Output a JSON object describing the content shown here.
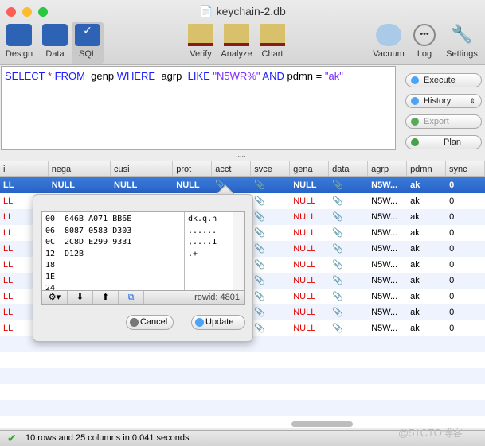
{
  "window": {
    "title": "keychain-2.db"
  },
  "toolbar": {
    "left": [
      {
        "label": "Design"
      },
      {
        "label": "Data"
      },
      {
        "label": "SQL",
        "selected": true
      }
    ],
    "center": [
      {
        "label": "Verify"
      },
      {
        "label": "Analyze"
      },
      {
        "label": "Chart"
      }
    ],
    "right": [
      {
        "label": "Vacuum"
      },
      {
        "label": "Log"
      },
      {
        "label": "Settings"
      }
    ]
  },
  "query": {
    "select": "SELECT",
    "star": "*",
    "from": "FROM",
    "table": "genp",
    "where": "WHERE",
    "col1": "agrp",
    "like": "LIKE",
    "pattern": "\"N5WR%\"",
    "and": "AND",
    "col2": "pdmn",
    "eq": "=",
    "value": "\"ak\""
  },
  "actions": {
    "execute": "Execute",
    "history": "History",
    "export": "Export",
    "plan": "Plan"
  },
  "grid": {
    "columns": [
      "i",
      "nega",
      "cusi",
      "prot",
      "acct",
      "svce",
      "gena",
      "data",
      "agrp",
      "pdmn",
      "sync"
    ],
    "selected_row": [
      "LL",
      "NULL",
      "NULL",
      "NULL",
      "",
      "",
      "NULL",
      "",
      "N5W...",
      "ak",
      "0"
    ],
    "row": [
      "LL",
      "",
      "",
      "",
      "",
      "",
      "NULL",
      "",
      "N5W...",
      "ak",
      "0"
    ],
    "row_count": 10
  },
  "popover": {
    "offsets": [
      "00",
      "06",
      "0C",
      "12",
      "18",
      "1E",
      "24"
    ],
    "hex": [
      "646B A071 BB6E",
      "8087 0583 D303",
      "2C8D E299 9331",
      "D12B"
    ],
    "ascii": [
      "dk.q.n",
      "......",
      ",....1",
      ".+"
    ],
    "rowid": "rowid: 4801",
    "cancel": "Cancel",
    "update": "Update"
  },
  "status": {
    "text": "10 rows and 25 columns in 0.041 seconds"
  },
  "watermark": "@51CTO博客",
  "colors": {
    "selection": "#2f6fd0",
    "null": "#e00000",
    "keyword": "#1a1aff",
    "string": "#7b2bff"
  }
}
